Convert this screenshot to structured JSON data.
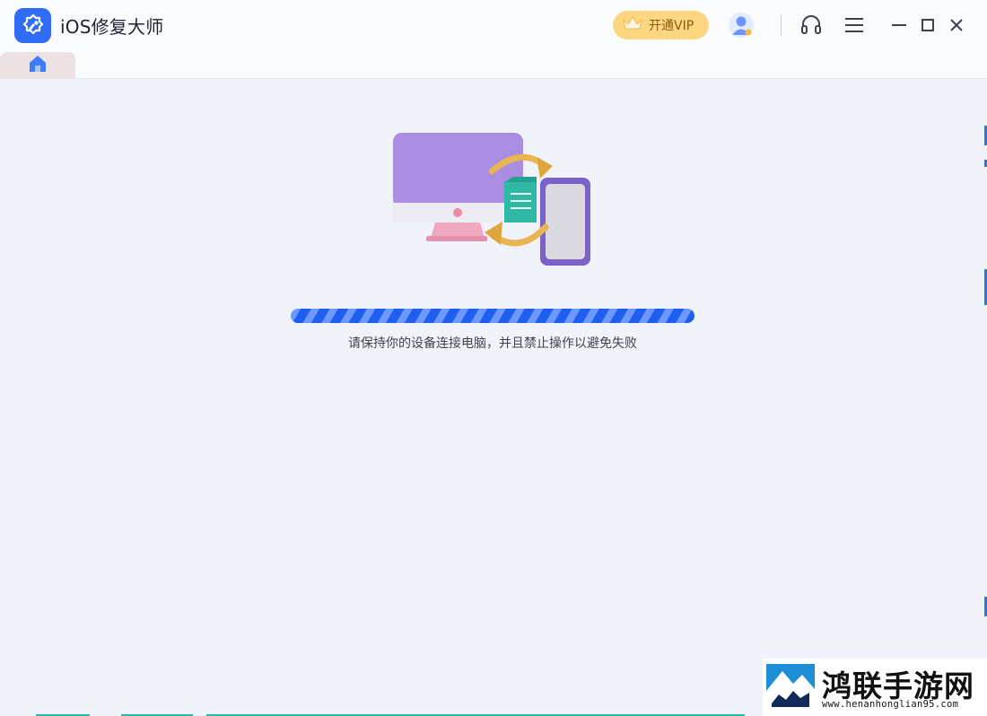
{
  "app": {
    "title": "iOS修复大师"
  },
  "header": {
    "vip_label": "开通VIP",
    "icons": [
      "app-logo-icon",
      "crown-icon",
      "user-avatar-icon",
      "headset-icon",
      "menu-icon",
      "minimize-icon",
      "maximize-icon",
      "close-icon"
    ]
  },
  "tabs": [
    {
      "icon": "home-icon"
    }
  ],
  "main": {
    "progress_indeterminate": true,
    "status_text": "请保持你的设备连接电脑，并且禁止操作以避免失败"
  },
  "watermark": {
    "title": "鸿联手游网",
    "url": "www.henanhonglian95.com"
  },
  "colors": {
    "accent": "#2f6df6",
    "vip": "#fcd681",
    "background": "#f0f3fa",
    "progress": "#1e5ff0"
  }
}
